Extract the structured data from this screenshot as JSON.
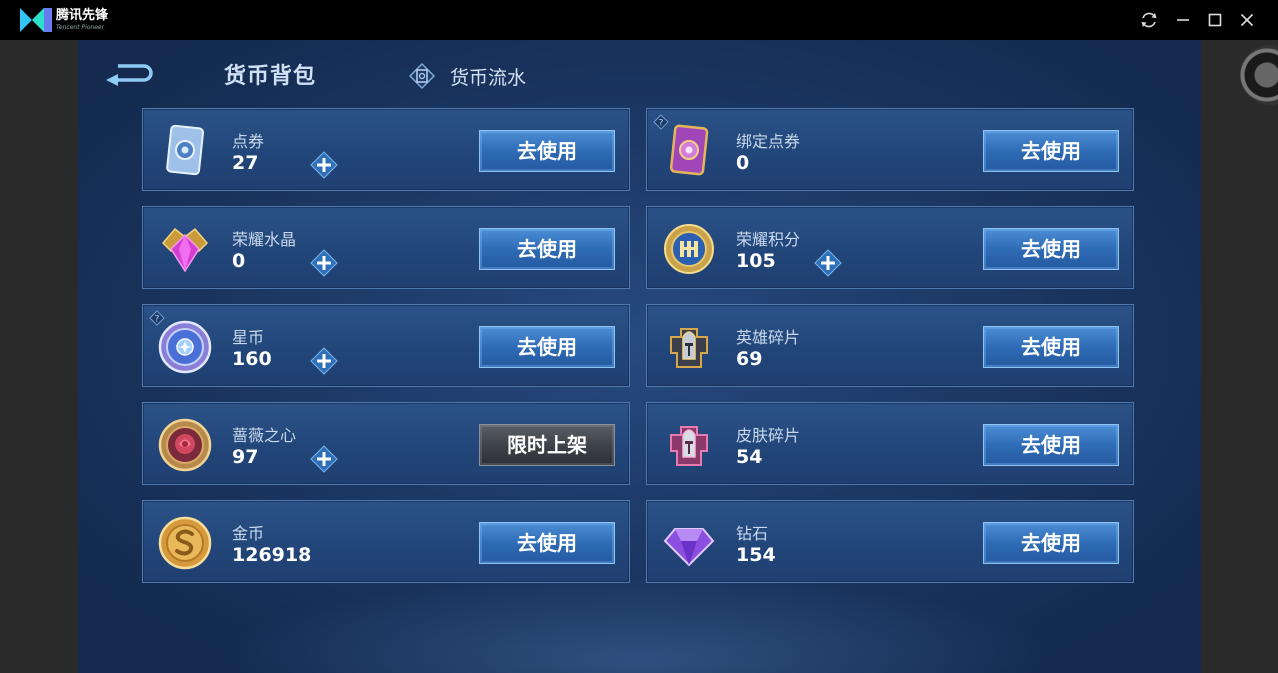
{
  "titlebar": {
    "app_name": "腾讯先锋",
    "app_subtitle": "Tencent Pioneer",
    "icons": [
      "refresh-icon",
      "minimize-icon",
      "maximize-icon",
      "close-icon"
    ]
  },
  "header": {
    "tab_wallet": "货币背包",
    "tab_flow": "货币流水"
  },
  "currencies": [
    {
      "label": "点券",
      "value": "27",
      "button": "去使用",
      "icon": "coupon-icon",
      "plus": true,
      "help": false
    },
    {
      "label": "绑定点券",
      "value": "0",
      "button": "去使用",
      "icon": "bound-coupon-icon",
      "plus": false,
      "help": true
    },
    {
      "label": "荣耀水晶",
      "value": "0",
      "button": "去使用",
      "icon": "crystal-icon",
      "plus": true,
      "help": false
    },
    {
      "label": "荣耀积分",
      "value": "105",
      "button": "去使用",
      "icon": "honor-points-icon",
      "plus": true,
      "help": false
    },
    {
      "label": "星币",
      "value": "160",
      "button": "去使用",
      "icon": "star-coin-icon",
      "plus": true,
      "help": true
    },
    {
      "label": "英雄碎片",
      "value": "69",
      "button": "去使用",
      "icon": "hero-fragment-icon",
      "plus": false,
      "help": false
    },
    {
      "label": "蔷薇之心",
      "value": "97",
      "button": "限时上架",
      "icon": "rose-heart-icon",
      "plus": true,
      "help": false
    },
    {
      "label": "皮肤碎片",
      "value": "54",
      "button": "去使用",
      "icon": "skin-fragment-icon",
      "plus": false,
      "help": false
    },
    {
      "label": "金币",
      "value": "126918",
      "button": "去使用",
      "icon": "gold-coin-icon",
      "plus": false,
      "help": false
    },
    {
      "label": "钻石",
      "value": "154",
      "button": "去使用",
      "icon": "diamond-icon",
      "plus": false,
      "help": false
    }
  ],
  "colors": {
    "background": "#1a3560",
    "card": "#22467a",
    "button": "#2f6cb6",
    "button_disabled": "#3c4047",
    "text_primary": "#ffffff",
    "text_label": "#c9d8ec"
  }
}
